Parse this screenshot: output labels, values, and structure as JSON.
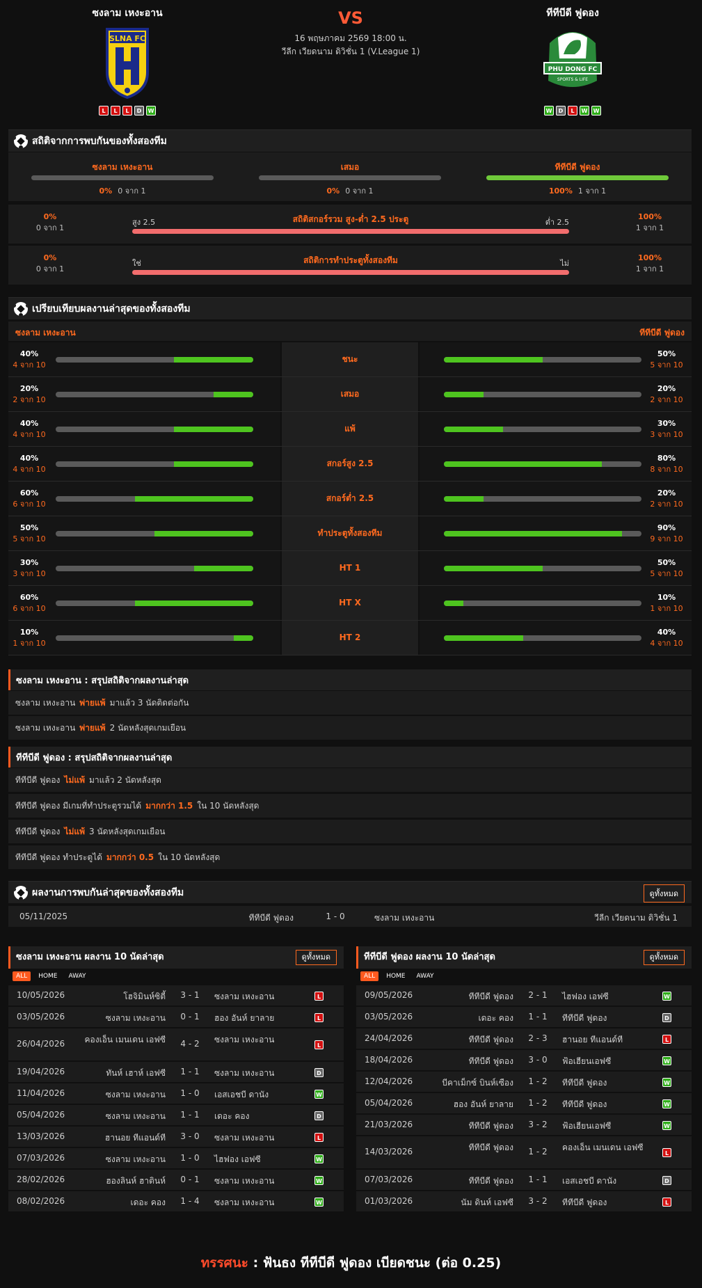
{
  "header": {
    "home_team": "ซงลาม เหงะอาน",
    "away_team": "ทีทีบีดี ฟูดอง",
    "vs": "VS",
    "datetime": "16 พฤษภาคม 2569 18:00 น.",
    "league": "วีลีก เวียดนาม ดิวิชั่น 1 (V.League 1)",
    "home_form": [
      "L",
      "L",
      "L",
      "D",
      "W"
    ],
    "away_form": [
      "W",
      "D",
      "L",
      "W",
      "W"
    ],
    "home_crest_text": "SLNA FC",
    "away_crest_text": "PHU DONG FC",
    "away_crest_subtext": "SPORTS & LIFE"
  },
  "h2h_stats": {
    "title": "สถิติจากการพบกันของทั้งสองทีม",
    "cols": [
      {
        "label": "ซงลาม เหงะอาน",
        "pct": "0%",
        "of": "0 จาก 1",
        "value": 0
      },
      {
        "label": "เสมอ",
        "pct": "0%",
        "of": "0 จาก 1",
        "value": 0
      },
      {
        "label": "ทีทีบีดี ฟูดอง",
        "pct": "100%",
        "of": "1 จาก 1",
        "value": 100
      }
    ],
    "ou": {
      "title": "สถิติสกอร์รวม สูง-ต่ำ 2.5 ประตู",
      "left_label": "สูง 2.5",
      "right_label": "ต่ำ 2.5",
      "left_pct": "0%",
      "left_of": "0 จาก 1",
      "right_pct": "100%",
      "right_of": "1 จาก 1"
    },
    "btts": {
      "title": "สถิติการทำประตูทั้งสองทีม",
      "left_label": "ใช่",
      "right_label": "ไม่",
      "left_pct": "0%",
      "left_of": "0 จาก 1",
      "right_pct": "100%",
      "right_of": "1 จาก 1"
    }
  },
  "compare": {
    "title": "เปรียบเทียบผลงานล่าสุดของทั้งสองทีม",
    "home_label": "ซงลาม เหงะอาน",
    "away_label": "ทีทีบีดี ฟูดอง",
    "rows": [
      {
        "label": "ชนะ",
        "home_pct": "40%",
        "home_of": "4 จาก 10",
        "home_val": 40,
        "away_pct": "50%",
        "away_of": "5 จาก 10",
        "away_val": 50
      },
      {
        "label": "เสมอ",
        "home_pct": "20%",
        "home_of": "2 จาก 10",
        "home_val": 20,
        "away_pct": "20%",
        "away_of": "2 จาก 10",
        "away_val": 20
      },
      {
        "label": "แพ้",
        "home_pct": "40%",
        "home_of": "4 จาก 10",
        "home_val": 40,
        "away_pct": "30%",
        "away_of": "3 จาก 10",
        "away_val": 30
      },
      {
        "label": "สกอร์สูง 2.5",
        "home_pct": "40%",
        "home_of": "4 จาก 10",
        "home_val": 40,
        "away_pct": "80%",
        "away_of": "8 จาก 10",
        "away_val": 80
      },
      {
        "label": "สกอร์ต่ำ 2.5",
        "home_pct": "60%",
        "home_of": "6 จาก 10",
        "home_val": 60,
        "away_pct": "20%",
        "away_of": "2 จาก 10",
        "away_val": 20
      },
      {
        "label": "ทำประตูทั้งสองทีม",
        "home_pct": "50%",
        "home_of": "5 จาก 10",
        "home_val": 50,
        "away_pct": "90%",
        "away_of": "9 จาก 10",
        "away_val": 90
      },
      {
        "label": "HT 1",
        "home_pct": "30%",
        "home_of": "3 จาก 10",
        "home_val": 30,
        "away_pct": "50%",
        "away_of": "5 จาก 10",
        "away_val": 50
      },
      {
        "label": "HT X",
        "home_pct": "60%",
        "home_of": "6 จาก 10",
        "home_val": 60,
        "away_pct": "10%",
        "away_of": "1 จาก 10",
        "away_val": 10
      },
      {
        "label": "HT 2",
        "home_pct": "10%",
        "home_of": "1 จาก 10",
        "home_val": 10,
        "away_pct": "40%",
        "away_of": "4 จาก 10",
        "away_val": 40
      }
    ]
  },
  "home_summary": {
    "title": "ซงลาม เหงะอาน : สรุปสถิติจากผลงานล่าสุด",
    "rows": [
      [
        "ซงลาม เหงะอาน",
        "พ่ายแพ้",
        "มาแล้ว 3 นัดติดต่อกัน"
      ],
      [
        "ซงลาม เหงะอาน",
        "พ่ายแพ้",
        "2  นัดหลังสุดเกมเยือน"
      ]
    ]
  },
  "away_summary": {
    "title": "ทีทีบีดี ฟูดอง : สรุปสถิติจากผลงานล่าสุด",
    "rows": [
      [
        "ทีทีบีดี ฟูดอง",
        "ไม่แพ้",
        "มาแล้ว 2 นัดหลังสุด"
      ],
      [
        "ทีทีบีดี ฟูดอง  มีเกมที่ทำประตูรวมได้",
        "มากกว่า  1.5",
        "ใน 10 นัดหลังสุด"
      ],
      [
        "ทีทีบีดี ฟูดอง",
        "ไม่แพ้",
        "3  นัดหลังสุดเกมเยือน"
      ],
      [
        "ทีทีบีดี ฟูดอง  ทำประตูได้",
        "มากกว่า  0.5",
        "ใน 10 นัดหลังสุด"
      ]
    ]
  },
  "last_h2h": {
    "title": "ผลงานการพบกันล่าสุดของทั้งสองทีม",
    "see_all": "ดูทั้งหมด",
    "match": {
      "date": "05/11/2025",
      "home": "ทีทีบีดี ฟูดอง",
      "score": "1 - 0",
      "away": "ซงลาม เหงะอาน",
      "league": "วีลีก เวียดนาม ดิวิชั่น 1"
    }
  },
  "home_recent": {
    "title": "ซงลาม เหงะอาน ผลงาน 10 นัดล่าสุด",
    "see_all": "ดูทั้งหมด",
    "tabs": [
      "ALL",
      "HOME",
      "AWAY"
    ],
    "rows": [
      {
        "date": "10/05/2026",
        "home": "โฮจิมินห์ซิตี้",
        "score": "3 - 1",
        "away": "ซงลาม เหงะอาน",
        "r": "L"
      },
      {
        "date": "03/05/2026",
        "home": "ซงลาม เหงะอาน",
        "score": "0 - 1",
        "away": "ฮอง อันห์ ยาลาย",
        "r": "L"
      },
      {
        "date": "26/04/2026",
        "home": "คองเอ็น เมนเดน เอฟซี",
        "score": "4 - 2",
        "away": "ซงลาม เหงะอาน",
        "r": "L",
        "tall": true
      },
      {
        "date": "19/04/2026",
        "home": "ทันห์ เฮาห์ เอฟซี",
        "score": "1 - 1",
        "away": "ซงลาม เหงะอาน",
        "r": "D"
      },
      {
        "date": "11/04/2026",
        "home": "ซงลาม เหงะอาน",
        "score": "1 - 0",
        "away": "เอสเอชบี ดานัง",
        "r": "W"
      },
      {
        "date": "05/04/2026",
        "home": "ซงลาม เหงะอาน",
        "score": "1 - 1",
        "away": "เดอะ คอง",
        "r": "D"
      },
      {
        "date": "13/03/2026",
        "home": "ฮานอย ทีแอนด์ที",
        "score": "3 - 0",
        "away": "ซงลาม เหงะอาน",
        "r": "L"
      },
      {
        "date": "07/03/2026",
        "home": "ซงลาม เหงะอาน",
        "score": "1 - 0",
        "away": "ไฮฟอง เอฟซี",
        "r": "W"
      },
      {
        "date": "28/02/2026",
        "home": "ฮองลินห์ ฮาตินห์",
        "score": "0 - 1",
        "away": "ซงลาม เหงะอาน",
        "r": "W"
      },
      {
        "date": "08/02/2026",
        "home": "เดอะ คอง",
        "score": "1 - 4",
        "away": "ซงลาม เหงะอาน",
        "r": "W"
      }
    ]
  },
  "away_recent": {
    "title": "ทีทีบีดี ฟูดอง ผลงาน 10 นัดล่าสุด",
    "see_all": "ดูทั้งหมด",
    "tabs": [
      "ALL",
      "HOME",
      "AWAY"
    ],
    "rows": [
      {
        "date": "09/05/2026",
        "home": "ทีทีบีดี ฟูดอง",
        "score": "2 - 1",
        "away": "ไฮฟอง เอฟซี",
        "r": "W"
      },
      {
        "date": "03/05/2026",
        "home": "เดอะ คอง",
        "score": "1 - 1",
        "away": "ทีทีบีดี ฟูดอง",
        "r": "D"
      },
      {
        "date": "24/04/2026",
        "home": "ทีทีบีดี ฟูดอง",
        "score": "2 - 3",
        "away": "ฮานอย ทีแอนด์ที",
        "r": "L"
      },
      {
        "date": "18/04/2026",
        "home": "ทีทีบีดี ฟูดอง",
        "score": "3 - 0",
        "away": "ฟ้อเฮียนเอฟซี",
        "r": "W"
      },
      {
        "date": "12/04/2026",
        "home": "บีคาเม็กซ์ บินห์เซือง",
        "score": "1 - 2",
        "away": "ทีทีบีดี ฟูดอง",
        "r": "W"
      },
      {
        "date": "05/04/2026",
        "home": "ฮอง อันห์ ยาลาย",
        "score": "1 - 2",
        "away": "ทีทีบีดี ฟูดอง",
        "r": "W"
      },
      {
        "date": "21/03/2026",
        "home": "ทีทีบีดี ฟูดอง",
        "score": "3 - 2",
        "away": "ฟ้อเฮียนเอฟซี",
        "r": "W"
      },
      {
        "date": "14/03/2026",
        "home": "ทีทีบีดี ฟูดอง",
        "score": "1 - 2",
        "away": "คองเอ็น เมนเดน เอฟซี",
        "r": "L",
        "tall": true
      },
      {
        "date": "07/03/2026",
        "home": "ทีทีบีดี ฟูดอง",
        "score": "1 - 1",
        "away": "เอสเอชบี ดานัง",
        "r": "D"
      },
      {
        "date": "01/03/2026",
        "home": "นัม ดินห์ เอฟซี",
        "score": "3 - 2",
        "away": "ทีทีบีดี ฟูดอง",
        "r": "L"
      }
    ]
  },
  "verdict": {
    "label": "ทรรศนะ",
    "sep": ":",
    "text": "ฟันธง ทีทีบีดี ฟูดอง เบียดชนะ (ต่อ 0.25)"
  }
}
